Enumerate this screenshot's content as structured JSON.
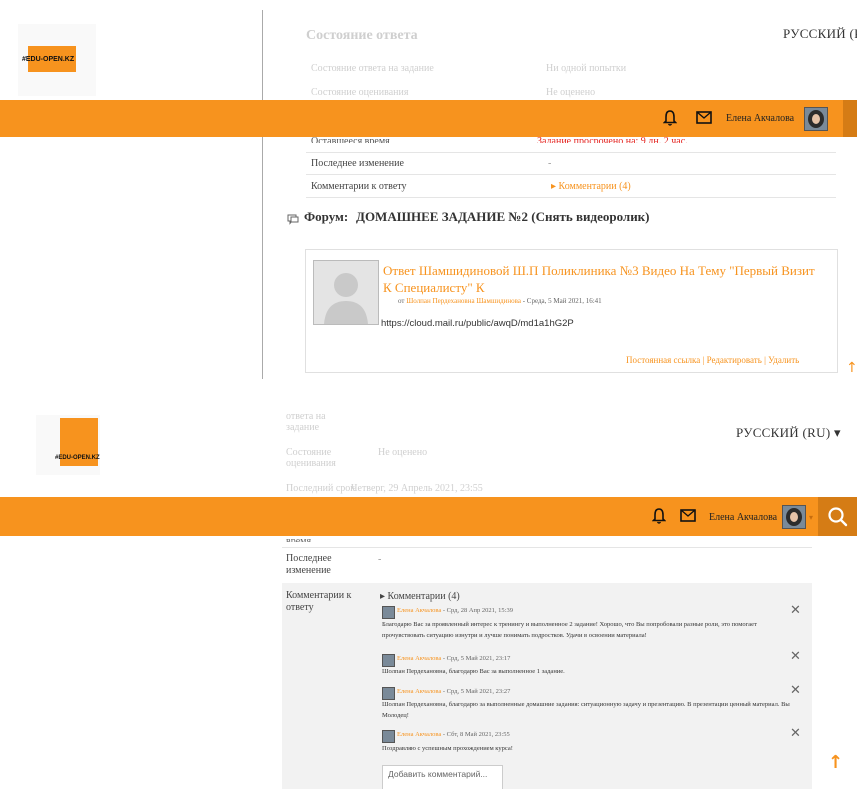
{
  "brand": {
    "logo_text": "#EDU-OPEN.KZ"
  },
  "language": {
    "label1": "РУССКИЙ (RU",
    "label2": "РУССКИЙ (RU) ▾"
  },
  "user": {
    "name": "Елена Акчалова"
  },
  "colors": {
    "accent": "#f7931e",
    "accent_dark": "#d57c15"
  },
  "icons": {
    "bell": "bell-icon",
    "mail": "envelope-icon",
    "search": "search-icon",
    "close": "close-icon",
    "up": "scroll-up-icon"
  },
  "panel1": {
    "status_heading": "Состояние ответа",
    "rows_faded": [
      {
        "label": "Состояние ответа на задание",
        "value": "Ни одной попытки"
      },
      {
        "label": "Состояние оценивания",
        "value": "Не оценено"
      }
    ],
    "overdue_label": "Оставшееся время",
    "overdue_value": "Задание просрочено на: 9 дн. 2 час.",
    "rows": [
      {
        "label": "Последнее изменение",
        "value": "-"
      },
      {
        "label": "Комментарии к ответу",
        "value": "▸ Комментарии (4)"
      }
    ],
    "forum_prefix": "Форум:",
    "forum_name": "ДОМАШНЕЕ ЗАДАНИЕ №2 (Снять видеоролик)",
    "post": {
      "title": "Ответ Шамшидиновой Ш.П Поликлиника №3 Видео На Тему \"Первый Визит К Специалисту\" К",
      "meta_prefix": "от",
      "meta_author": "Шолпан Пердехановна Шамшидинова",
      "meta_date": " - Среда, 5 Май 2021, 16:41",
      "link": "https://cloud.mail.ru/public/awqD/md1a1hG2P",
      "actions": "Постоянная ссылка | Редактировать | Удалить"
    }
  },
  "panel2": {
    "faded_top": "ответа на задание",
    "faded_rows": [
      {
        "label": "Состояние оценивания",
        "value": "Не оценено"
      },
      {
        "label": "Последний срок",
        "value": "Четверг, 29 Апрель 2021, 23:55"
      }
    ],
    "hidden_label": "время",
    "rows": [
      {
        "label": "Последнее изменение",
        "value": "-"
      }
    ],
    "comments_label": "Комментарии к ответу",
    "comments_toggle": "▸ Комментарии (4)",
    "comments": [
      {
        "author": "Елена Акчалова",
        "date": " - Срд, 28 Апр 2021, 15:39",
        "text": "Благодарю Вас за проявленный интерес к тренингу и выполненное 2 задание! Хорошо, что Вы попробовали разные роли, это помогает прочувствовать ситуацию изнутри и лучше понимать подростков. Удачи в освоении материала!"
      },
      {
        "author": "Елена Акчалова",
        "date": " - Срд, 5 Май 2021, 23:17",
        "text": "Шолпан Пердехановна, благодарю Вас за выполненное 1 задание."
      },
      {
        "author": "Елена Акчалова",
        "date": " - Срд, 5 Май 2021, 23:27",
        "text": "Шолпан Пердехановна, благодарю за выполненные домашние задания: ситуационную задачу и презентацию. В презентации ценный материал. Вы Молодец!"
      },
      {
        "author": "Елена Акчалова",
        "date": " - Сбт, 8 Май 2021, 23:55",
        "text": "Поздравляю с успешным прохождением курса!"
      }
    ],
    "add_comment_placeholder": "Добавить комментарий..."
  }
}
